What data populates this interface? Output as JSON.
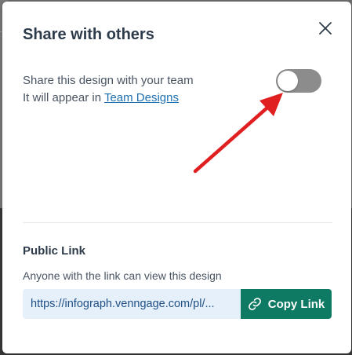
{
  "dialog": {
    "title": "Share with others",
    "close_icon": "close-icon"
  },
  "team_share": {
    "line1": "Share this design with your team",
    "line2_prefix": "It will appear in ",
    "link_label": "Team Designs",
    "toggle_on": false
  },
  "public_link": {
    "title": "Public Link",
    "description": "Anyone with the link can view this design",
    "url": "https://infograph.venngage.com/pl/...",
    "copy_label": "Copy Link",
    "copy_icon": "link-icon"
  },
  "annotation": {
    "icon": "red-arrow-icon",
    "color": "#e02020"
  },
  "colors": {
    "accent": "#0e7a63",
    "link": "#1e6fb0",
    "toggle_off": "#8c8c8c"
  }
}
